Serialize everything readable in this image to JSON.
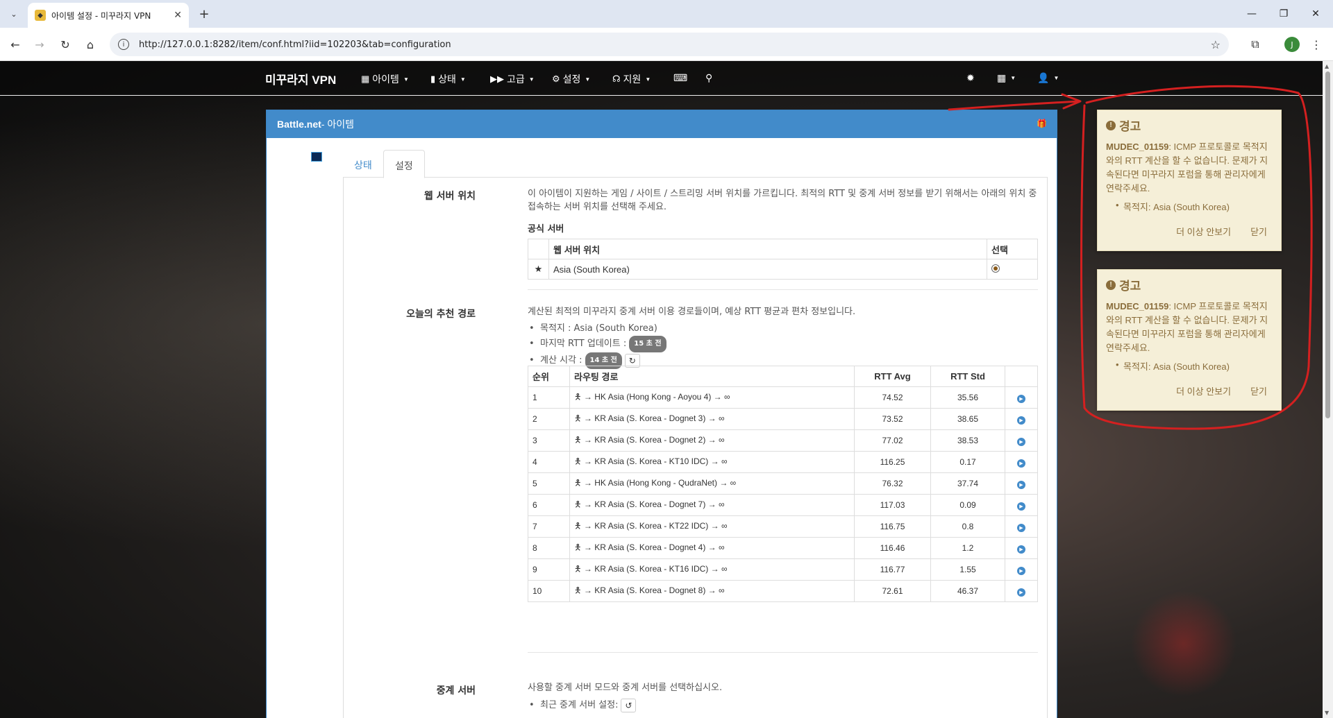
{
  "browser": {
    "tab_title": "아이템 설정 - 미꾸라지 VPN",
    "url": "http://127.0.0.1:8282/item/conf.html?iid=102203&tab=configuration",
    "profile_initial": "J"
  },
  "nav": {
    "brand": "미꾸라지 VPN",
    "menus": [
      {
        "label": "아이템",
        "icon": "grid-icon"
      },
      {
        "label": "상태",
        "icon": "bar-chart-icon"
      },
      {
        "label": "고급",
        "icon": "fast-forward-icon"
      },
      {
        "label": "설정",
        "icon": "gear-icon"
      },
      {
        "label": "지원",
        "icon": "headphones-icon"
      }
    ]
  },
  "panel": {
    "title_bold": "Battle.net",
    "title_rest": " - 아이템",
    "tabs": [
      "상태",
      "설정"
    ],
    "active_tab": "설정"
  },
  "web_server": {
    "label": "웹 서버 위치",
    "desc": "이 아이템이 지원하는 게임 / 사이트 / 스트리밍 서버 위치를 가르킵니다. 최적의 RTT 및 중계 서버 정보를 받기 위해서는 아래의 위치 중 접속하는 서버 위치를 선택해 주세요.",
    "official_heading": "공식 서버",
    "columns": [
      "웹 서버 위치",
      "선택"
    ],
    "rows": [
      {
        "location": "Asia (South Korea)",
        "selected": true
      }
    ]
  },
  "recommended": {
    "label": "오늘의 추천 경로",
    "desc": "계산된 최적의 미꾸라지 중계 서버 이용 경로들이며, 예상 RTT 평균과 편차 정보입니다.",
    "destination": "목적지 : Asia (South Korea)",
    "last_update_label": "마지막 RTT 업데이트 :",
    "last_update_badge": "15 초 전",
    "calc_label": "계산 시각 :",
    "calc_badge": "14 초 전",
    "columns": [
      "순위",
      "라우팅 경로",
      "RTT Avg",
      "RTT Std"
    ],
    "rows": [
      {
        "rank": "1",
        "route": "→ HK Asia (Hong Kong - Aoyou 4) →",
        "avg": "74.52",
        "std": "35.56"
      },
      {
        "rank": "2",
        "route": "→ KR Asia (S. Korea - Dognet 3) →",
        "avg": "73.52",
        "std": "38.65"
      },
      {
        "rank": "3",
        "route": "→ KR Asia (S. Korea - Dognet 2) →",
        "avg": "77.02",
        "std": "38.53"
      },
      {
        "rank": "4",
        "route": "→ KR Asia (S. Korea - KT10 IDC) →",
        "avg": "116.25",
        "std": "0.17"
      },
      {
        "rank": "5",
        "route": "→ HK Asia (Hong Kong - QudraNet) →",
        "avg": "76.32",
        "std": "37.74"
      },
      {
        "rank": "6",
        "route": "→ KR Asia (S. Korea - Dognet 7) →",
        "avg": "117.03",
        "std": "0.09"
      },
      {
        "rank": "7",
        "route": "→ KR Asia (S. Korea - KT22 IDC) →",
        "avg": "116.75",
        "std": "0.8"
      },
      {
        "rank": "8",
        "route": "→ KR Asia (S. Korea - Dognet 4) →",
        "avg": "116.46",
        "std": "1.2"
      },
      {
        "rank": "9",
        "route": "→ KR Asia (S. Korea - KT16 IDC) →",
        "avg": "116.77",
        "std": "1.55"
      },
      {
        "rank": "10",
        "route": "→ KR Asia (S. Korea - Dognet 8) →",
        "avg": "72.61",
        "std": "46.37"
      }
    ]
  },
  "relay": {
    "label": "중계 서버",
    "desc": "사용할 중계 서버 모드와 중계 서버를 선택하십시오.",
    "recent_label": "최근 중계 서버 설정:"
  },
  "warnings": [
    {
      "title": "경고",
      "code": "MUDEC_01159",
      "message": ": ICMP 프로토콜로 목적지와의 RTT 계산을 할 수 없습니다. 문제가 지속된다면 미꾸라지 포럼을 통해 관리자에게 연락주세요.",
      "item": "목적지: Asia (South Korea)",
      "dont_show": "더 이상 안보기",
      "close": "닫기"
    },
    {
      "title": "경고",
      "code": "MUDEC_01159",
      "message": ": ICMP 프로토콜로 목적지와의 RTT 계산을 할 수 없습니다. 문제가 지속된다면 미꾸라지 포럼을 통해 관리자에게 연락주세요.",
      "item": "목적지: Asia (South Korea)",
      "dont_show": "더 이상 안보기",
      "close": "닫기"
    }
  ],
  "annotation_color": "#d42020"
}
